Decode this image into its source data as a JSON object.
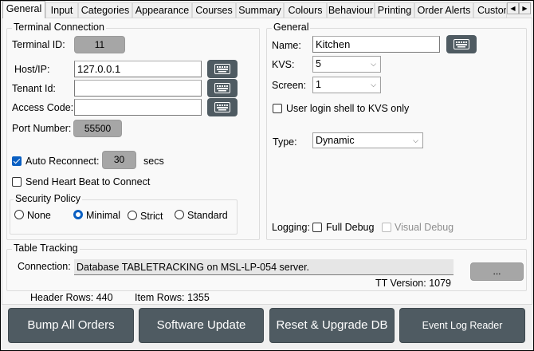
{
  "tabs": [
    "General",
    "Input",
    "Categories",
    "Appearance",
    "Courses",
    "Summary",
    "Colours",
    "Behaviour",
    "Printing",
    "Order Alerts",
    "Custom"
  ],
  "terminal": {
    "title": "Terminal Connection",
    "terminal_id_label": "Terminal ID:",
    "terminal_id": "11",
    "host_label": "Host/IP:",
    "host": "127.0.0.1",
    "tenant_label": "Tenant Id:",
    "tenant": "",
    "access_label": "Access Code:",
    "access": "",
    "port_label": "Port Number:",
    "port": "55500",
    "auto_reconnect_label": "Auto Reconnect:",
    "auto_reconnect": true,
    "reconnect_secs": "30",
    "secs_label": "secs",
    "heartbeat_label": "Send Heart Beat to Connect",
    "heartbeat": false,
    "security": {
      "title": "Security Policy",
      "options": [
        "None",
        "Minimal",
        "Strict",
        "Standard"
      ],
      "selected": "Minimal"
    }
  },
  "general": {
    "title": "General",
    "name_label": "Name:",
    "name": "Kitchen",
    "kvs_label": "KVS:",
    "kvs": "5",
    "screen_label": "Screen:",
    "screen": "1",
    "login_shell_label": "User login shell to KVS only",
    "login_shell": false,
    "type_label": "Type:",
    "type": "Dynamic",
    "logging_label": "Logging:",
    "full_debug_label": "Full Debug",
    "full_debug": false,
    "visual_debug_label": "Visual Debug",
    "visual_debug": false
  },
  "table_tracking": {
    "title": "Table Tracking",
    "connection_label": "Connection:",
    "connection": "Database TABLETRACKING on MSL-LP-054 server.",
    "tt_version": "TT Version: 1079",
    "browse_label": "..."
  },
  "stats": {
    "header_rows": "Header Rows:  440",
    "item_rows": "Item Rows:  1355"
  },
  "buttons": [
    "Bump All Orders",
    "Software Update",
    "Reset & Upgrade DB",
    "Event Log Reader"
  ]
}
